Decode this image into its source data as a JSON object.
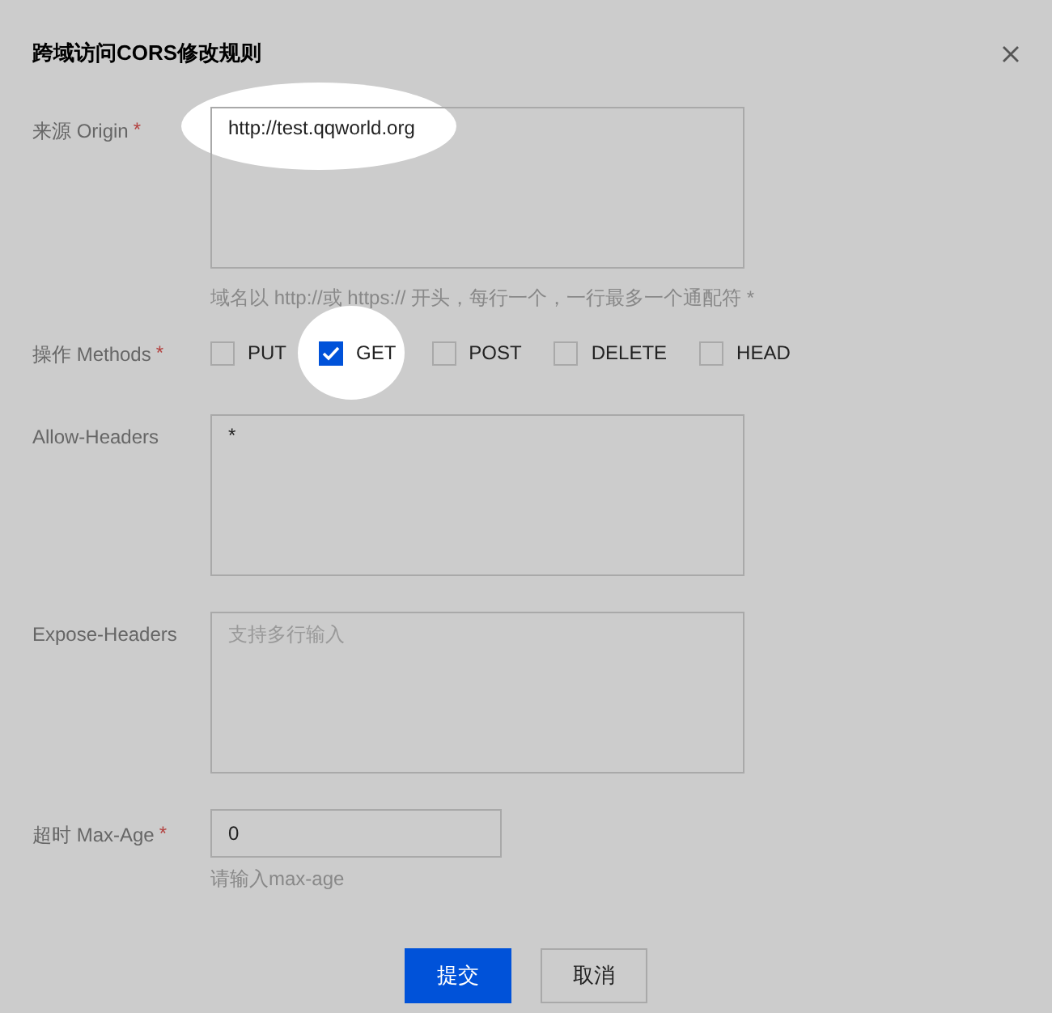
{
  "dialog": {
    "title": "跨域访问CORS修改规则"
  },
  "fields": [
    {
      "kind": "textarea",
      "label": "来源 Origin",
      "required_mark": "*",
      "value": "http://test.qqworld.org",
      "highlighted": true,
      "hint": "域名以 http://或 https:// 开头，每行一个，一行最多一个通配符 *"
    },
    {
      "kind": "checkboxes",
      "label": "操作 Methods",
      "required_mark": "*",
      "options": [
        {
          "label": "PUT",
          "checked": false,
          "highlighted": false
        },
        {
          "label": "GET",
          "checked": true,
          "highlighted": true
        },
        {
          "label": "POST",
          "checked": false,
          "highlighted": false
        },
        {
          "label": "DELETE",
          "checked": false,
          "highlighted": false
        },
        {
          "label": "HEAD",
          "checked": false,
          "highlighted": false
        }
      ]
    },
    {
      "kind": "textarea",
      "label": "Allow-Headers",
      "value": "*",
      "highlighted": false
    },
    {
      "kind": "textarea",
      "label": "Expose-Headers",
      "placeholder": "支持多行输入",
      "highlighted": false
    },
    {
      "kind": "input",
      "label": "超时 Max-Age",
      "required_mark": "*",
      "value": "0",
      "hint": "请输入max-age"
    }
  ],
  "buttons": [
    {
      "label": "提交",
      "primary": true
    },
    {
      "label": "取消",
      "primary": false
    }
  ]
}
